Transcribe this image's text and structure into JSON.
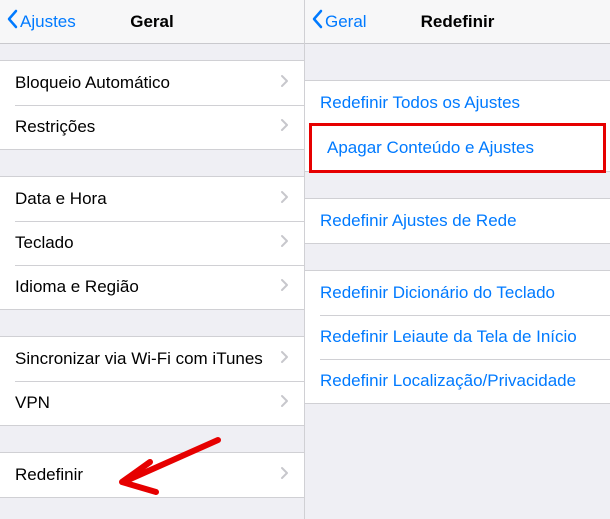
{
  "left": {
    "back_label": "Ajustes",
    "title": "Geral",
    "group1": [
      {
        "label": "Bloqueio Automático"
      },
      {
        "label": "Restrições"
      }
    ],
    "group2": [
      {
        "label": "Data e Hora"
      },
      {
        "label": "Teclado"
      },
      {
        "label": "Idioma e Região"
      }
    ],
    "group3": [
      {
        "label": "Sincronizar via Wi-Fi com iTunes"
      },
      {
        "label": "VPN"
      }
    ],
    "group4": [
      {
        "label": "Redefinir"
      }
    ]
  },
  "right": {
    "back_label": "Geral",
    "title": "Redefinir",
    "group1": [
      {
        "label": "Redefinir Todos os Ajustes"
      },
      {
        "label": "Apagar Conteúdo e Ajustes",
        "highlighted": true
      }
    ],
    "group2": [
      {
        "label": "Redefinir Ajustes de Rede"
      }
    ],
    "group3": [
      {
        "label": "Redefinir Dicionário do Teclado"
      },
      {
        "label": "Redefinir Leiaute da Tela de Início"
      },
      {
        "label": "Redefinir Localização/Privacidade"
      }
    ]
  },
  "colors": {
    "ios_blue": "#007aff",
    "annotation_red": "#e60000"
  }
}
